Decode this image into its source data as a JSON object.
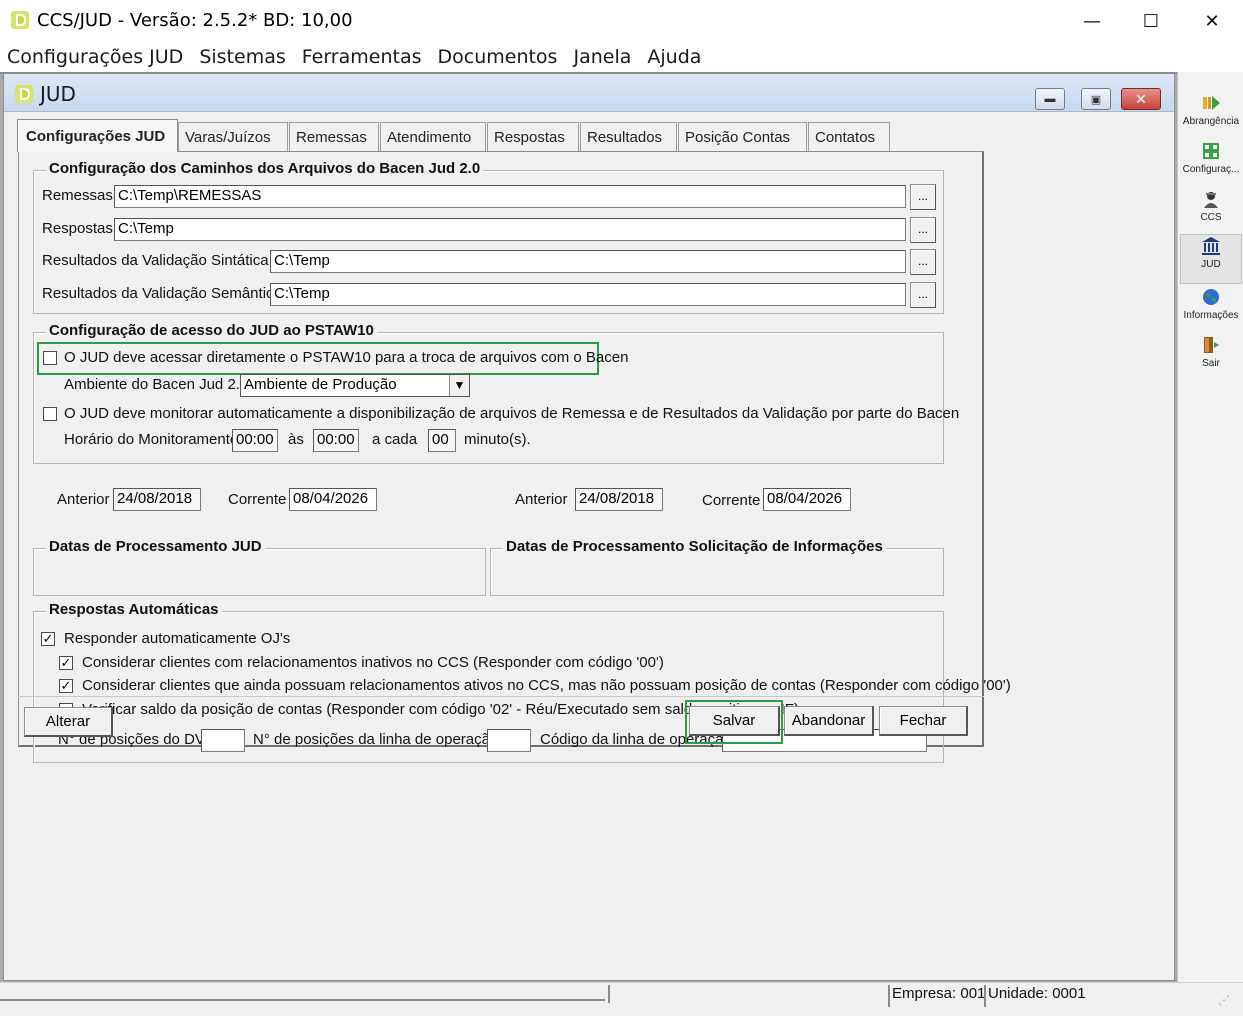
{
  "window": {
    "title": "CCS/JUD - Versão: 2.5.2* BD: 10,00",
    "minimize": "—",
    "maximize": "☐",
    "close": "✕"
  },
  "menu": [
    "Configurações JUD",
    "Sistemas",
    "Ferramentas",
    "Documentos",
    "Janela",
    "Ajuda"
  ],
  "child_window": {
    "title": "JUD"
  },
  "tabs": [
    "Configurações JUD",
    "Varas/Juízos",
    "Remessas",
    "Atendimento",
    "Respostas",
    "Resultados",
    "Posição Contas",
    "Contatos"
  ],
  "paths_group": {
    "title": "Configuração dos Caminhos dos Arquivos do Bacen Jud 2.0",
    "rows": [
      {
        "label": "Remessas",
        "value": "C:\\Temp\\REMESSAS"
      },
      {
        "label": "Respostas",
        "value": "C:\\Temp"
      },
      {
        "label": "Resultados da Validação Sintática",
        "value": "C:\\Temp"
      },
      {
        "label": "Resultados da Validação Semântica",
        "value": "C:\\Temp"
      }
    ],
    "browse_label": "..."
  },
  "access_group": {
    "title": "Configuração de acesso do JUD ao PSTAW10",
    "direct_access_label": "O JUD deve acessar diretamente o PSTAW10 para a troca de arquivos com o Bacen",
    "direct_access_checked": false,
    "ambiente_label": "Ambiente do Bacen Jud 2.0",
    "ambiente_value": "Ambiente de Produção",
    "monitor_label": "O JUD deve monitorar automaticamente a disponibilização de arquivos de Remessa e de Resultados da Validação por parte do Bacen",
    "monitor_checked": false,
    "horario_label": "Horário do Monitoramento",
    "horario_from": "00:00",
    "as_label": "às",
    "horario_to": "00:00",
    "a_cada_label": "a cada",
    "interval": "00",
    "minutos_label": "minuto(s)."
  },
  "dates_jud": {
    "title": "Datas de Processamento JUD",
    "anterior_label": "Anterior",
    "anterior": "24/08/2018",
    "corrente_label": "Corrente",
    "corrente": "08/04/2026"
  },
  "dates_sol": {
    "title": "Datas de Processamento Solicitação de Informações",
    "anterior_label": "Anterior",
    "anterior": "24/08/2018",
    "corrente_label": "Corrente",
    "corrente": "08/04/2026"
  },
  "auto_group": {
    "title": "Respostas Automáticas",
    "options": [
      {
        "label": "Responder automaticamente OJ's",
        "checked": true
      },
      {
        "label": "Considerar clientes com relacionamentos inativos no CCS (Responder com código '00')",
        "checked": true
      },
      {
        "label": "Considerar clientes que ainda possuam relacionamentos ativos no CCS, mas não possuam posição de contas (Responder com código '00')",
        "checked": true
      },
      {
        "label": "Verificar saldo da posição de contas (Responder com código '02' - Réu/Executado sem saldo positivo na IF)",
        "checked": false
      }
    ],
    "dv_label": "N° de posições do DV",
    "dv_value": "",
    "linha_label": "N° de posições da linha de operação",
    "linha_value": "",
    "codigo_label": "Código da linha de operação",
    "codigo_value": ""
  },
  "buttons": {
    "alterar": "Alterar",
    "salvar": "Salvar",
    "abandonar": "Abandonar",
    "fechar": "Fechar"
  },
  "toolbar": [
    {
      "label": "Abrangência",
      "icon": "abrangencia-icon"
    },
    {
      "label": "Configuraç...",
      "icon": "configuracoes-icon"
    },
    {
      "label": "CCS",
      "icon": "ccs-icon"
    },
    {
      "label": "JUD",
      "icon": "bank-icon"
    },
    {
      "label": "Informações",
      "icon": "globe-icon"
    },
    {
      "label": "Sair",
      "icon": "exit-door-icon"
    }
  ],
  "status": {
    "empresa": "Empresa: 001",
    "unidade": "Unidade: 0001"
  },
  "colors": {
    "highlight": "#2e9b47",
    "mdi_background": "#ababab",
    "app_icon": "#c6d84a"
  }
}
